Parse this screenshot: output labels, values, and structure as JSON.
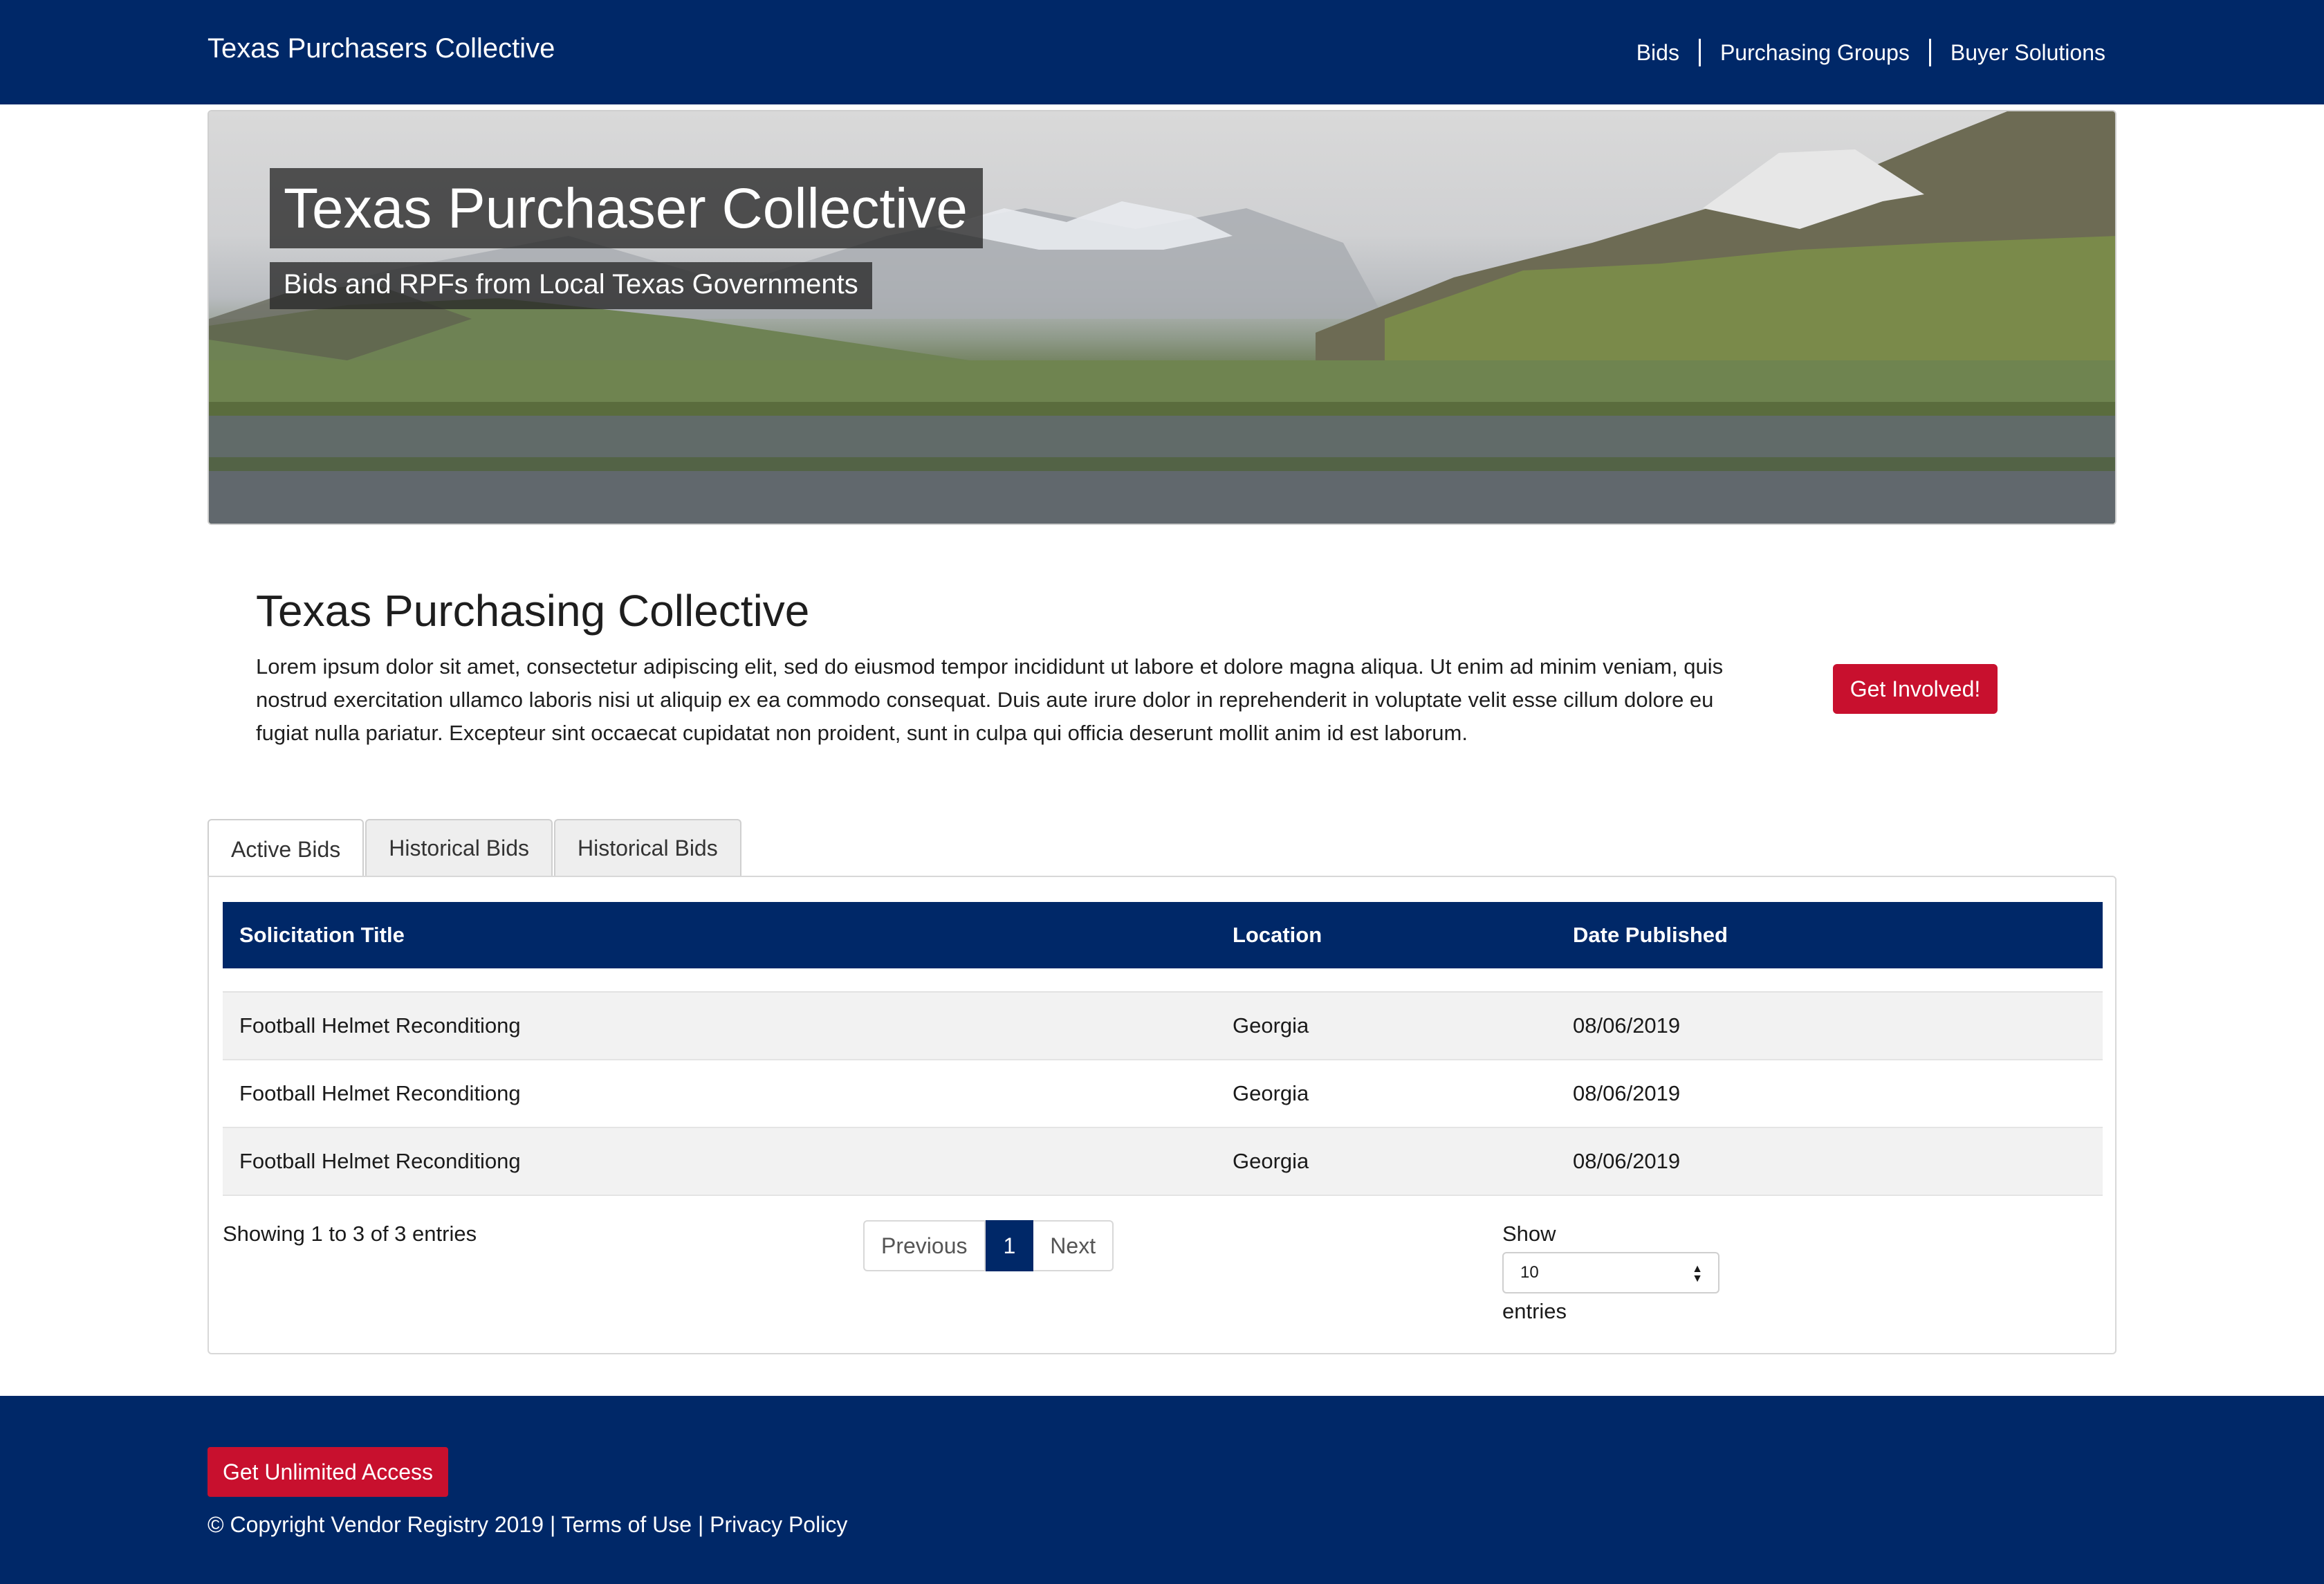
{
  "header": {
    "brand": "Texas Purchasers Collective",
    "nav": [
      "Bids",
      "Purchasing Groups",
      "Buyer Solutions"
    ]
  },
  "hero": {
    "title": "Texas Purchaser Collective",
    "subtitle": "Bids and RPFs from Local Texas Governments"
  },
  "intro": {
    "title": "Texas Purchasing Collective",
    "body": "Lorem ipsum dolor sit amet, consectetur adipiscing elit, sed do eiusmod tempor incididunt ut labore et dolore magna aliqua. Ut enim ad minim veniam, quis nostrud exercitation ullamco laboris nisi ut aliquip ex ea commodo consequat. Duis aute irure dolor in reprehenderit in voluptate velit esse cillum dolore eu fugiat nulla pariatur. Excepteur sint occaecat cupidatat non proident, sunt in culpa qui officia deserunt mollit anim id est laborum.",
    "cta_label": "Get Involved!"
  },
  "tabs": [
    "Active Bids",
    "Historical Bids",
    "Historical Bids"
  ],
  "table": {
    "columns": [
      "Solicitation Title",
      "Location",
      "Date Published"
    ],
    "rows": [
      [
        "Football Helmet Reconditiong",
        "Georgia",
        "08/06/2019"
      ],
      [
        "Football Helmet Reconditiong",
        "Georgia",
        "08/06/2019"
      ],
      [
        "Football Helmet Reconditiong",
        "Georgia",
        "08/06/2019"
      ]
    ]
  },
  "pagination": {
    "info": "Showing 1 to 3 of 3 entries",
    "previous": "Previous",
    "current": "1",
    "next": "Next"
  },
  "page_length": {
    "show_label": "Show",
    "selected": "10",
    "entries_label": "entries"
  },
  "footer": {
    "button_label": "Get Unlimited Access",
    "copyright": "© Copyright Vendor Registry 2019",
    "terms": "Terms of Use",
    "privacy": "Privacy Policy",
    "separator": "|"
  },
  "colors": {
    "navy": "#002868",
    "red": "#c8102e"
  }
}
